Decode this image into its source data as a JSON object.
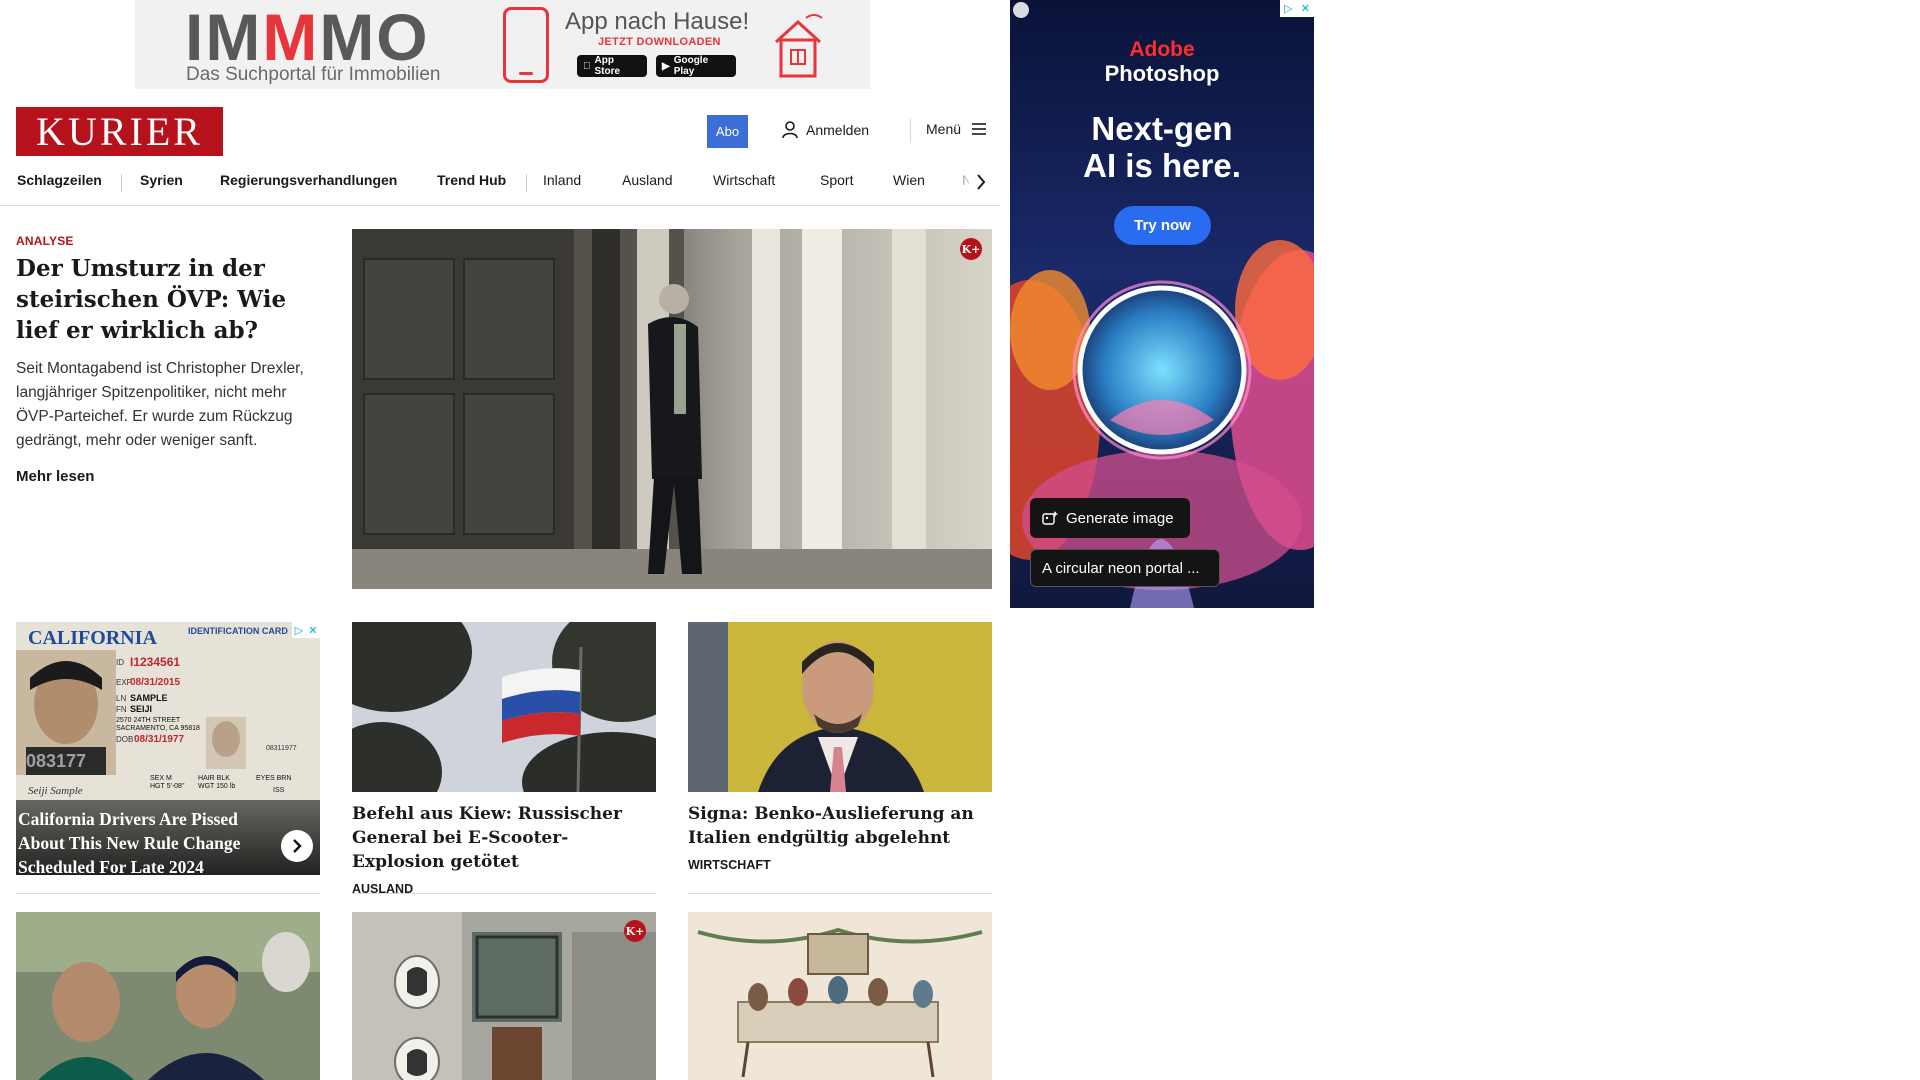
{
  "top_ad": {
    "brand_pre": "IM",
    "brand_accent": "M",
    "brand_post": "MO",
    "tagline": "Das Suchportal für Immobilien",
    "headline": "App nach Hause!",
    "subline": "JETZT DOWNLOADEN",
    "app_store": "App Store",
    "google_play": "Google Play"
  },
  "header": {
    "logo": "KURIER",
    "abo": "Abo",
    "login": "Anmelden",
    "menu": "Menü"
  },
  "nav": {
    "items": [
      "Schlagzeilen",
      "Syrien",
      "Regierungsverhandlungen",
      "Trend Hub",
      "Inland",
      "Ausland",
      "Wirtschaft",
      "Sport",
      "Wien",
      "NÖ"
    ]
  },
  "hero": {
    "kicker": "ANALYSE",
    "title": "Der Umsturz in der steiri­schen ÖVP: Wie lief er wirklich ab?",
    "teaser": "Seit Montagabend ist Christopher Drexler, langjähriger Spitzenpolitiker, nicht mehr ÖVP-Parteichef. Er wurde zum Rückzug gedrängt, mehr oder weniger sanft.",
    "read_more": "Mehr lesen",
    "premium_badge": "K+"
  },
  "promo": {
    "title": "California Drivers Are Pissed About This New Rule Change Scheduled For Late 2024",
    "card_state": "CALIFORNIA",
    "card_type": "IDENTIFICATION CARD",
    "id_label": "ID",
    "id_value": "I1234561",
    "exp_label": "EXP",
    "exp_value": "08/31/2015",
    "ln_label": "LN",
    "ln_value": "SAMPLE",
    "fn_label": "FN",
    "fn_value": "SEIJI",
    "address_line1": "2570 24TH STREET",
    "address_line2": "SACRAMENTO, CA 95818",
    "dob_label": "DOB",
    "dob_value": "08/31/1977",
    "sex": "SEX M",
    "hair": "HAIR BLK",
    "eyes": "EYES BRN",
    "hgt": "HGT 5'-08\"",
    "wgt": "WGT 150 lb",
    "iss": "ISS",
    "doc_no": "08311977",
    "photo_no": "083177",
    "signature": "Seiji Sample"
  },
  "cards": [
    {
      "title": "Befehl aus Kiew: Russischer Gene­ral bei E-Scooter-Explosion getötet",
      "section": "AUSLAND"
    },
    {
      "title": "Signa: Benko-Auslieferung an Ita­lien endgültig abgelehnt",
      "section": "WIRTSCHAFT"
    }
  ],
  "side_ad": {
    "brand": "Adobe",
    "product": "Photoshop",
    "headline_1": "Next-gen",
    "headline_2": "AI is here.",
    "cta": "Try now",
    "generate": "Generate image",
    "prompt": "A circular neon portal ..."
  },
  "colors": {
    "brand_red": "#b5121b",
    "abo_blue": "#3c6ed6",
    "adobe_blue": "#2a6cf0"
  }
}
